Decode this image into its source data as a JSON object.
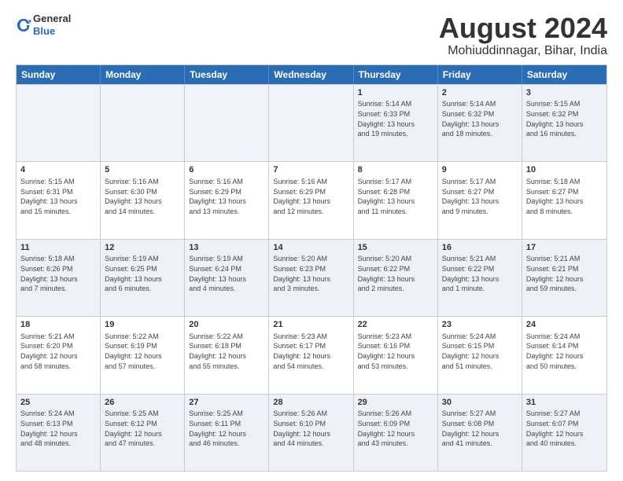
{
  "header": {
    "logo": {
      "line1": "General",
      "line2": "Blue"
    },
    "title": "August 2024",
    "location": "Mohiuddinnagar, Bihar, India"
  },
  "weekdays": [
    "Sunday",
    "Monday",
    "Tuesday",
    "Wednesday",
    "Thursday",
    "Friday",
    "Saturday"
  ],
  "weeks": [
    [
      {
        "day": "",
        "info": "",
        "empty": true
      },
      {
        "day": "",
        "info": "",
        "empty": true
      },
      {
        "day": "",
        "info": "",
        "empty": true
      },
      {
        "day": "",
        "info": "",
        "empty": true
      },
      {
        "day": "1",
        "info": "Sunrise: 5:14 AM\nSunset: 6:33 PM\nDaylight: 13 hours\nand 19 minutes."
      },
      {
        "day": "2",
        "info": "Sunrise: 5:14 AM\nSunset: 6:32 PM\nDaylight: 13 hours\nand 18 minutes."
      },
      {
        "day": "3",
        "info": "Sunrise: 5:15 AM\nSunset: 6:32 PM\nDaylight: 13 hours\nand 16 minutes."
      }
    ],
    [
      {
        "day": "4",
        "info": "Sunrise: 5:15 AM\nSunset: 6:31 PM\nDaylight: 13 hours\nand 15 minutes."
      },
      {
        "day": "5",
        "info": "Sunrise: 5:16 AM\nSunset: 6:30 PM\nDaylight: 13 hours\nand 14 minutes."
      },
      {
        "day": "6",
        "info": "Sunrise: 5:16 AM\nSunset: 6:29 PM\nDaylight: 13 hours\nand 13 minutes."
      },
      {
        "day": "7",
        "info": "Sunrise: 5:16 AM\nSunset: 6:29 PM\nDaylight: 13 hours\nand 12 minutes."
      },
      {
        "day": "8",
        "info": "Sunrise: 5:17 AM\nSunset: 6:28 PM\nDaylight: 13 hours\nand 11 minutes."
      },
      {
        "day": "9",
        "info": "Sunrise: 5:17 AM\nSunset: 6:27 PM\nDaylight: 13 hours\nand 9 minutes."
      },
      {
        "day": "10",
        "info": "Sunrise: 5:18 AM\nSunset: 6:27 PM\nDaylight: 13 hours\nand 8 minutes."
      }
    ],
    [
      {
        "day": "11",
        "info": "Sunrise: 5:18 AM\nSunset: 6:26 PM\nDaylight: 13 hours\nand 7 minutes."
      },
      {
        "day": "12",
        "info": "Sunrise: 5:19 AM\nSunset: 6:25 PM\nDaylight: 13 hours\nand 6 minutes."
      },
      {
        "day": "13",
        "info": "Sunrise: 5:19 AM\nSunset: 6:24 PM\nDaylight: 13 hours\nand 4 minutes."
      },
      {
        "day": "14",
        "info": "Sunrise: 5:20 AM\nSunset: 6:23 PM\nDaylight: 13 hours\nand 3 minutes."
      },
      {
        "day": "15",
        "info": "Sunrise: 5:20 AM\nSunset: 6:22 PM\nDaylight: 13 hours\nand 2 minutes."
      },
      {
        "day": "16",
        "info": "Sunrise: 5:21 AM\nSunset: 6:22 PM\nDaylight: 13 hours\nand 1 minute."
      },
      {
        "day": "17",
        "info": "Sunrise: 5:21 AM\nSunset: 6:21 PM\nDaylight: 12 hours\nand 59 minutes."
      }
    ],
    [
      {
        "day": "18",
        "info": "Sunrise: 5:21 AM\nSunset: 6:20 PM\nDaylight: 12 hours\nand 58 minutes."
      },
      {
        "day": "19",
        "info": "Sunrise: 5:22 AM\nSunset: 6:19 PM\nDaylight: 12 hours\nand 57 minutes."
      },
      {
        "day": "20",
        "info": "Sunrise: 5:22 AM\nSunset: 6:18 PM\nDaylight: 12 hours\nand 55 minutes."
      },
      {
        "day": "21",
        "info": "Sunrise: 5:23 AM\nSunset: 6:17 PM\nDaylight: 12 hours\nand 54 minutes."
      },
      {
        "day": "22",
        "info": "Sunrise: 5:23 AM\nSunset: 6:16 PM\nDaylight: 12 hours\nand 53 minutes."
      },
      {
        "day": "23",
        "info": "Sunrise: 5:24 AM\nSunset: 6:15 PM\nDaylight: 12 hours\nand 51 minutes."
      },
      {
        "day": "24",
        "info": "Sunrise: 5:24 AM\nSunset: 6:14 PM\nDaylight: 12 hours\nand 50 minutes."
      }
    ],
    [
      {
        "day": "25",
        "info": "Sunrise: 5:24 AM\nSunset: 6:13 PM\nDaylight: 12 hours\nand 48 minutes."
      },
      {
        "day": "26",
        "info": "Sunrise: 5:25 AM\nSunset: 6:12 PM\nDaylight: 12 hours\nand 47 minutes."
      },
      {
        "day": "27",
        "info": "Sunrise: 5:25 AM\nSunset: 6:11 PM\nDaylight: 12 hours\nand 46 minutes."
      },
      {
        "day": "28",
        "info": "Sunrise: 5:26 AM\nSunset: 6:10 PM\nDaylight: 12 hours\nand 44 minutes."
      },
      {
        "day": "29",
        "info": "Sunrise: 5:26 AM\nSunset: 6:09 PM\nDaylight: 12 hours\nand 43 minutes."
      },
      {
        "day": "30",
        "info": "Sunrise: 5:27 AM\nSunset: 6:08 PM\nDaylight: 12 hours\nand 41 minutes."
      },
      {
        "day": "31",
        "info": "Sunrise: 5:27 AM\nSunset: 6:07 PM\nDaylight: 12 hours\nand 40 minutes."
      }
    ]
  ],
  "altRows": [
    0,
    2,
    4
  ]
}
